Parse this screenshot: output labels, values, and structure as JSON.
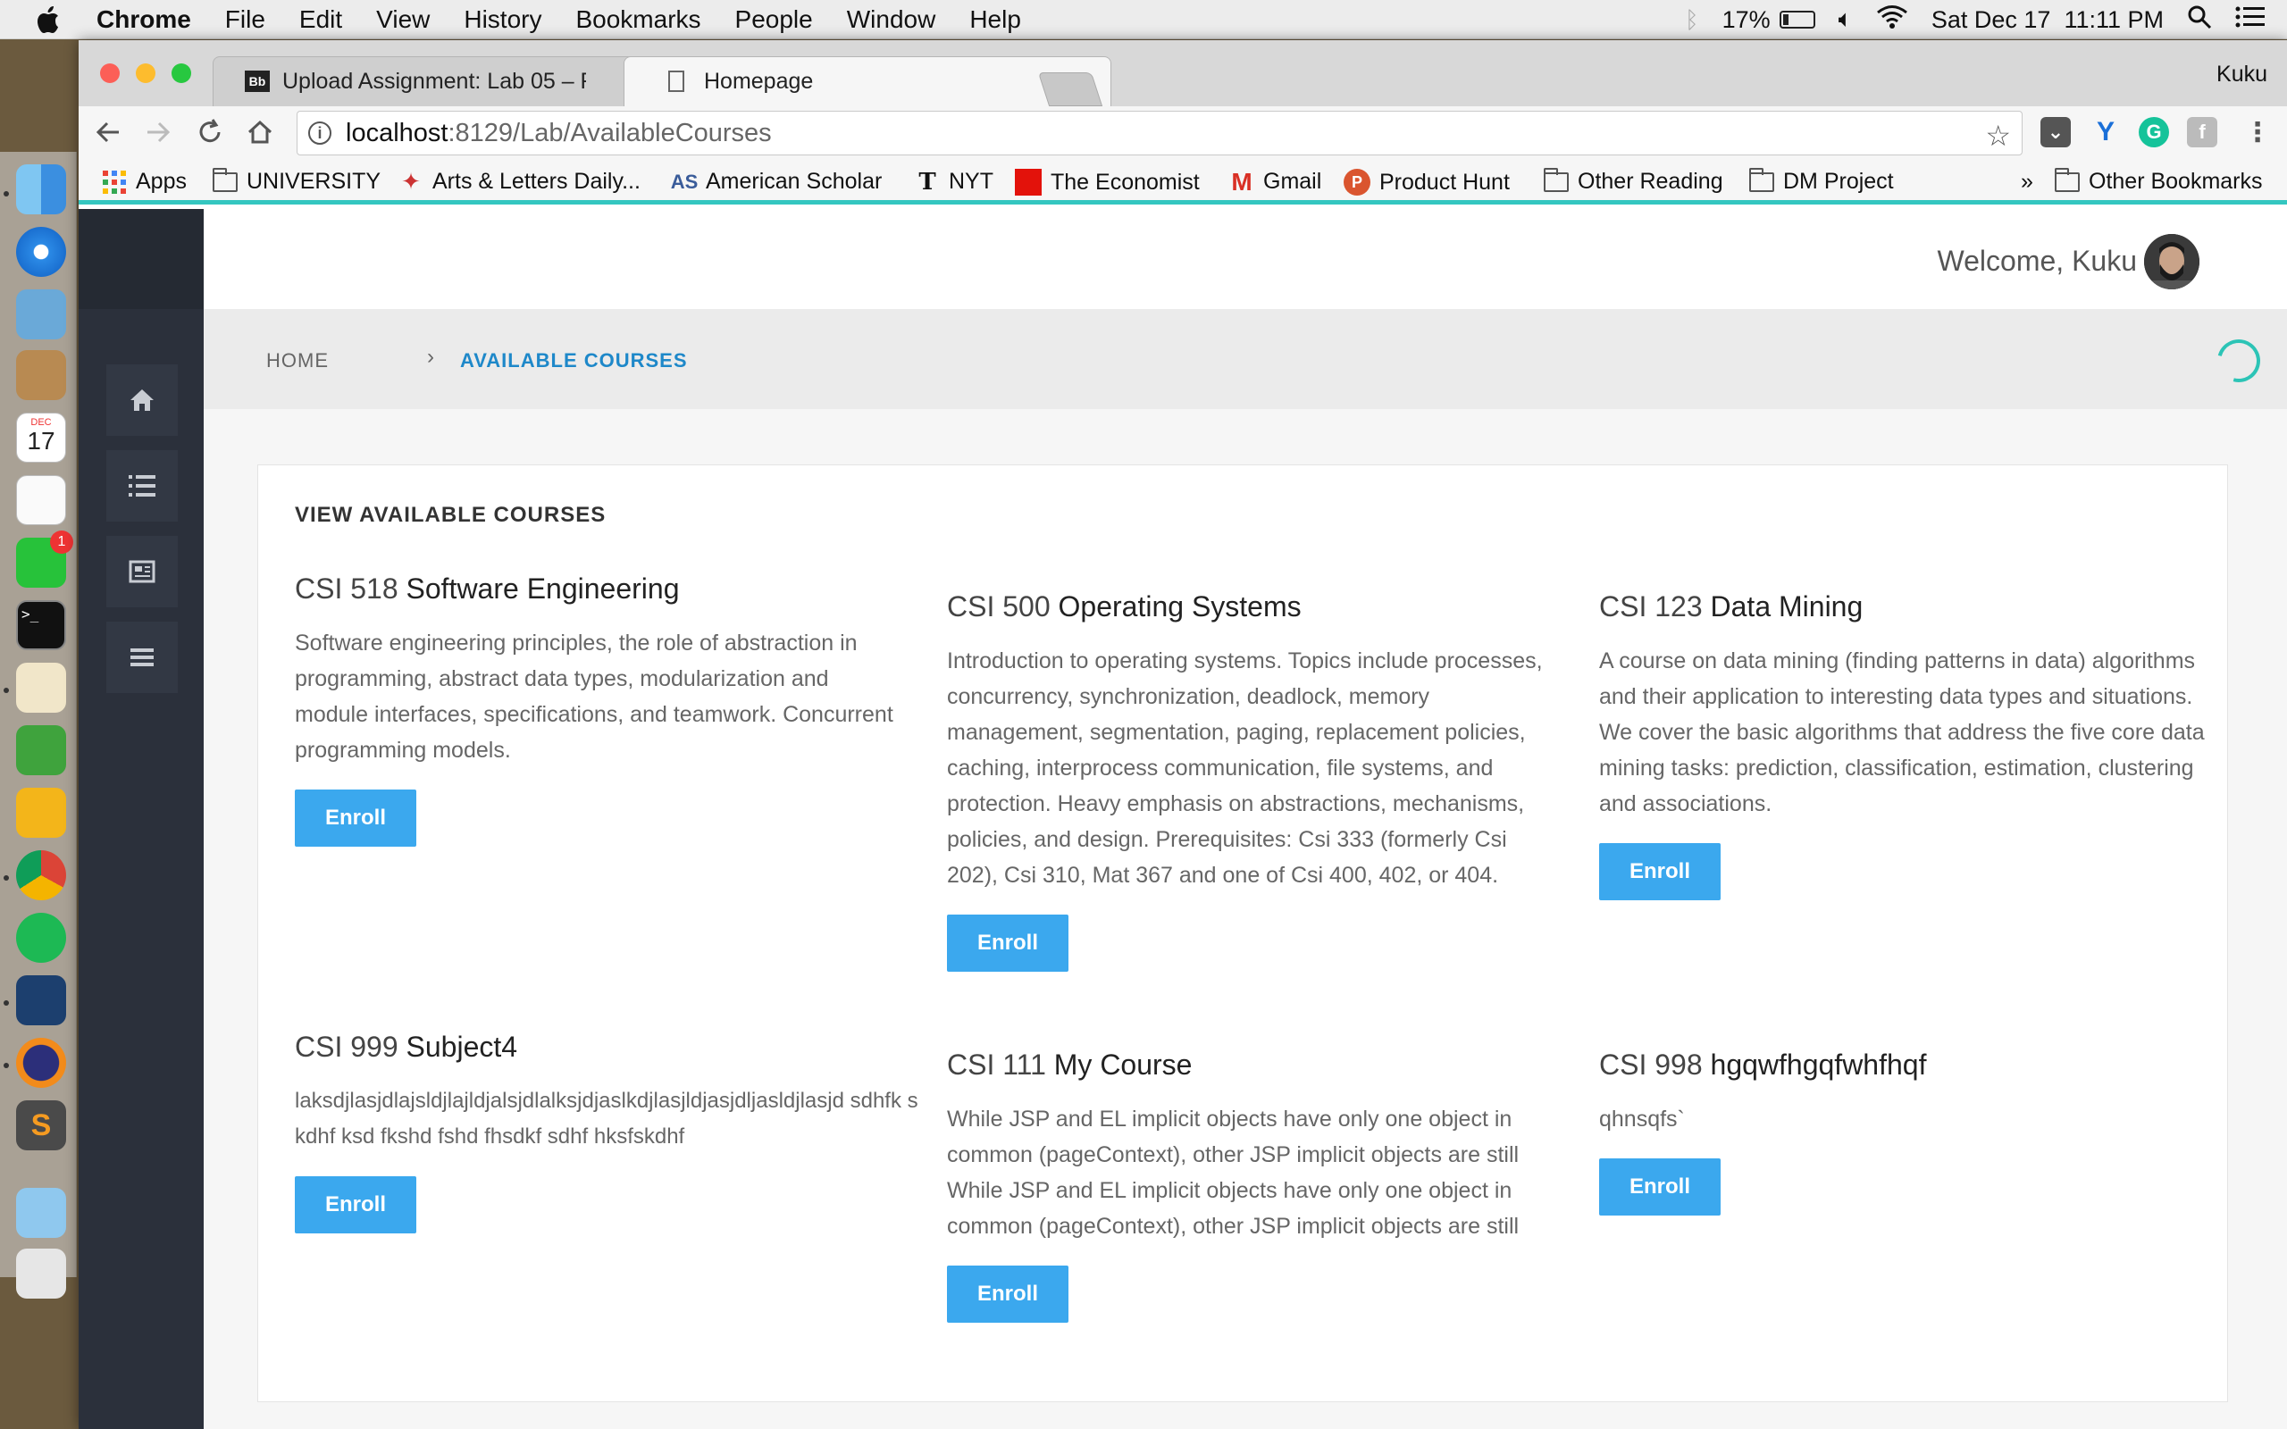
{
  "menubar": {
    "app": "Chrome",
    "items": [
      "File",
      "Edit",
      "View",
      "History",
      "Bookmarks",
      "People",
      "Window",
      "Help"
    ],
    "battery": "17%",
    "clock": "Sat Dec 17  11:11 PM"
  },
  "window": {
    "profile": "Kuku",
    "tabs": [
      {
        "title": "Upload Assignment: Lab 05 – F",
        "favicon": "Bb"
      },
      {
        "title": "Homepage"
      }
    ],
    "url": {
      "host": "localhost",
      "path": ":8129/Lab/AvailableCourses"
    },
    "bookmarks": [
      {
        "label": "Apps"
      },
      {
        "label": "UNIVERSITY"
      },
      {
        "label": "Arts & Letters Daily..."
      },
      {
        "label": "American Scholar"
      },
      {
        "label": "NYT"
      },
      {
        "label": "The Economist"
      },
      {
        "label": "Gmail"
      },
      {
        "label": "Product Hunt"
      },
      {
        "label": "Other Reading"
      },
      {
        "label": "DM Project"
      }
    ],
    "bookmarks_overflow": "»",
    "other_bookmarks": "Other Bookmarks"
  },
  "dock": {
    "calendar_month": "DEC",
    "calendar_day": "17",
    "facetime_badge": "1"
  },
  "page": {
    "welcome": "Welcome, Kuku",
    "breadcrumb": {
      "home": "HOME",
      "separator": "›",
      "current": "AVAILABLE COURSES"
    },
    "panel_title": "VIEW AVAILABLE COURSES",
    "enroll_label": "Enroll",
    "courses": [
      {
        "code": "CSI 518",
        "name": "Software Engineering",
        "description": "Software engineering principles, the role of abstraction in programming, abstract data types, modularization and module interfaces, specifications, and teamwork. Concurrent programming models."
      },
      {
        "code": "CSI 500",
        "name": "Operating Systems",
        "description": "Introduction to operating systems. Topics include processes, concurrency, synchronization, deadlock, memory management, segmentation, paging, replacement policies, caching, interprocess communication, file systems, and protection. Heavy emphasis on abstractions, mechanisms, policies, and design. Prerequisites: Csi 333 (formerly Csi 202), Csi 310, Mat 367 and one of Csi 400, 402, or 404."
      },
      {
        "code": "CSI 123",
        "name": "Data Mining",
        "description": "A course on data mining (finding patterns in data) algorithms and their application to interesting data types and situations. We cover the basic algorithms that address the five core data mining tasks: prediction, classification, estimation, clustering and associations."
      },
      {
        "code": "CSI 999",
        "name": "Subject4",
        "description": "laksdjlasjdlajsldjlajldjalsjdlalksjdjaslkdjlasjldjasjdljasldjlasjd sdhfk skdhf ksd fkshd fshd fhsdkf sdhf hksfskdhf"
      },
      {
        "code": "CSI 111",
        "name": "My Course",
        "description": "While JSP and EL implicit objects have only one object in common (pageContext), other JSP implicit objects are still While JSP and EL implicit objects have only one object in common (pageContext), other JSP implicit objects are still"
      },
      {
        "code": "CSI 998",
        "name": "hgqwfhgqfwhfhqf",
        "description": "qhnsqfs`"
      }
    ]
  }
}
